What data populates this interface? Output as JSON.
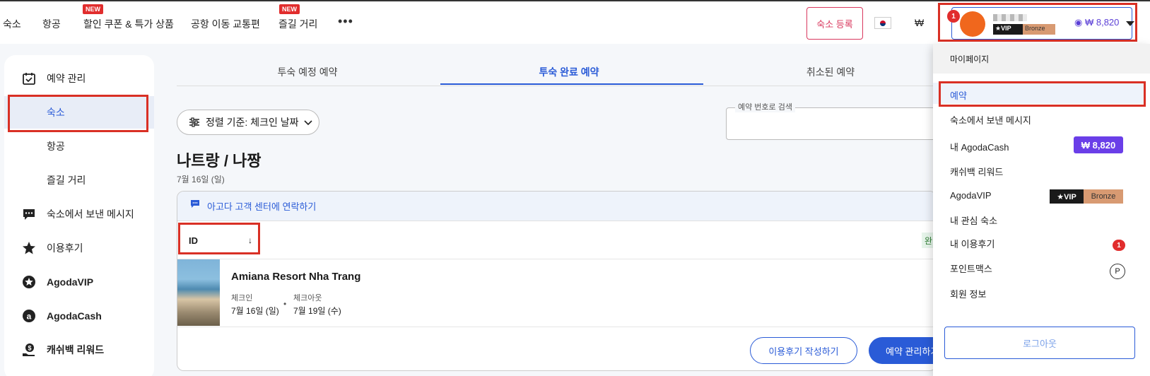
{
  "nav": {
    "items": [
      "숙소",
      "항공",
      "할인 쿠폰 & 특가 상품",
      "공항 이동 교통편",
      "즐길 거리"
    ],
    "new_badge": "NEW",
    "more": "•••",
    "register": "숙소 등록",
    "currency": "₩"
  },
  "account": {
    "notif_count": "1",
    "vip": "★VIP",
    "tier": "Bronze",
    "cash": "₩ 8,820"
  },
  "sidebar": {
    "items": [
      {
        "label": "예약 관리",
        "icon": "calendar-check-icon"
      },
      {
        "label": "숙소"
      },
      {
        "label": "항공"
      },
      {
        "label": "즐길 거리"
      },
      {
        "label": "숙소에서 보낸 메시지",
        "icon": "chat-icon"
      },
      {
        "label": "이용후기",
        "icon": "star-icon"
      },
      {
        "label": "AgodaVIP",
        "icon": "vip-star-icon"
      },
      {
        "label": "AgodaCash",
        "icon": "agodacash-icon"
      },
      {
        "label": "캐쉬백 리워드",
        "icon": "cashback-icon"
      }
    ]
  },
  "tabs": [
    "투숙 예정 예약",
    "투숙 완료 예약",
    "취소된 예약"
  ],
  "sort": {
    "label": "정렬 기준: 체크인 날짜"
  },
  "search": {
    "legend": "예약 번호로 검색"
  },
  "trip": {
    "city": "나트랑 / 나짱",
    "date": "7월 16일 (일)",
    "contact": "아고다 고객 센터에 연락하기",
    "id_label": "ID",
    "id_arrow": "↓",
    "status_partial": "완",
    "hotel": "Amiana Resort Nha Trang",
    "checkin_label": "체크인",
    "checkin_date": "7월 16일 (일)",
    "checkout_label": "체크아웃",
    "checkout_date": "7월 19일 (수)",
    "dot": "•",
    "review_btn": "이용후기 작성하기",
    "manage_btn": "예약 관리하기"
  },
  "dropdown": {
    "header": "마이페이지",
    "items": [
      "예약",
      "숙소에서 보낸 메시지",
      "내 AgodaCash",
      "캐쉬백 리워드",
      "AgodaVIP",
      "내 관심 숙소",
      "내 이용후기",
      "포인트맥스",
      "회원 정보"
    ],
    "cash": "₩ 8,820",
    "vip": "★VIP",
    "tier": "Bronze",
    "review_count": "1",
    "points_icon": "P",
    "logout": "로그아웃"
  },
  "colors": {
    "primary": "#2a5bd7",
    "highlight": "#d93025",
    "cash": "#6a3ee8"
  }
}
